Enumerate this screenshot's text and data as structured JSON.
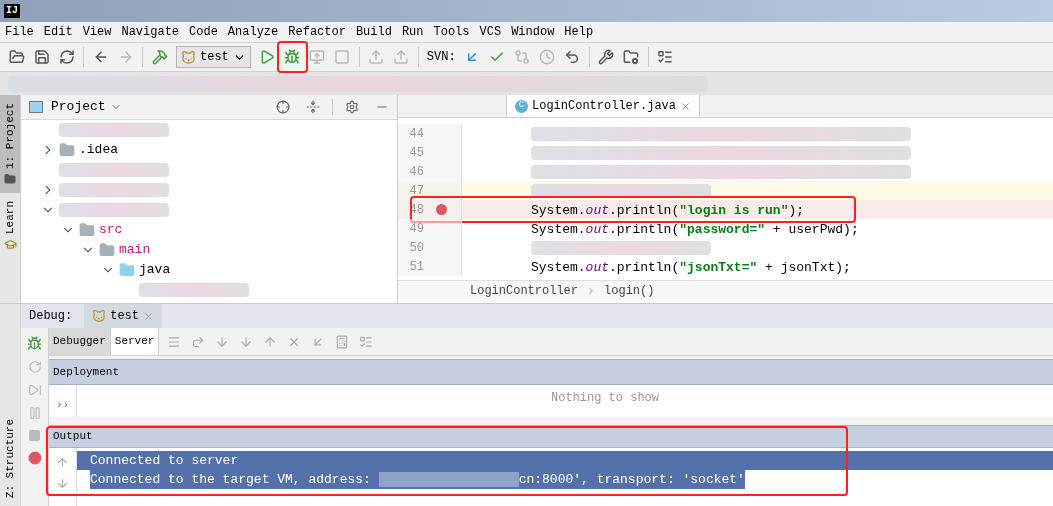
{
  "window": {
    "logo": "IJ"
  },
  "menu": [
    "File",
    "Edit",
    "View",
    "Navigate",
    "Code",
    "Analyze",
    "Refactor",
    "Build",
    "Run",
    "Tools",
    "VCS",
    "Window",
    "Help"
  ],
  "toolbar": [
    {
      "kind": "open",
      "disabled": false
    },
    {
      "kind": "save",
      "disabled": false
    },
    {
      "kind": "sync",
      "disabled": false
    },
    {
      "kind": "sep"
    },
    {
      "kind": "back",
      "disabled": false
    },
    {
      "kind": "forward",
      "disabled": true
    },
    {
      "kind": "sep"
    },
    {
      "kind": "build",
      "disabled": false
    },
    {
      "kind": "config",
      "label": "test"
    },
    {
      "kind": "run",
      "disabled": false
    },
    {
      "kind": "debug",
      "disabled": false,
      "annotated": true
    },
    {
      "kind": "coverage",
      "disabled": true
    },
    {
      "kind": "stop",
      "disabled": true
    },
    {
      "kind": "sep"
    },
    {
      "kind": "attach",
      "disabled": true
    },
    {
      "kind": "deploy",
      "disabled": true
    },
    {
      "kind": "sep"
    },
    {
      "kind": "label",
      "label": "SVN:"
    },
    {
      "kind": "update",
      "disabled": false
    },
    {
      "kind": "commit",
      "disabled": false
    },
    {
      "kind": "compare",
      "disabled": true
    },
    {
      "kind": "history",
      "disabled": true
    },
    {
      "kind": "revert",
      "disabled": false
    },
    {
      "kind": "sep"
    },
    {
      "kind": "settings",
      "disabled": false
    },
    {
      "kind": "structure",
      "disabled": false
    },
    {
      "kind": "sep"
    },
    {
      "kind": "tasks",
      "disabled": false
    }
  ],
  "side_tabs": [
    {
      "label": "1: Project",
      "kind": "folder",
      "selected": true
    },
    {
      "label": "Learn",
      "kind": "learn",
      "selected": false
    }
  ],
  "bottom_side_tab": {
    "label": "Z: Structure"
  },
  "project": {
    "title": "Project",
    "tree": [
      {
        "kind": "redacted"
      },
      {
        "kind": "folder",
        "label": ".idea",
        "expanded": false
      },
      {
        "kind": "redacted"
      },
      {
        "kind": "redacted",
        "expanded": false
      },
      {
        "kind": "redacted",
        "expanded": true,
        "children": [
          {
            "kind": "folder",
            "label": "src",
            "color": "#c3157a",
            "expanded": true,
            "children": [
              {
                "kind": "folder",
                "label": "main",
                "color": "#c3157a",
                "expanded": true,
                "children": [
                  {
                    "kind": "source",
                    "label": "java",
                    "expanded": true,
                    "children": [
                      {
                        "kind": "redacted"
                      }
                    ]
                  }
                ]
              }
            ]
          }
        ]
      }
    ]
  },
  "editor": {
    "tabs": [
      {
        "label": "LoginController.java",
        "icon": "C",
        "selected": true
      }
    ],
    "lines": [
      {
        "number": "44",
        "kind": "redacted"
      },
      {
        "number": "45",
        "kind": "redacted"
      },
      {
        "number": "46",
        "kind": "redacted"
      },
      {
        "number": "47",
        "kind": "redacted",
        "current": true
      },
      {
        "number": "48",
        "breakpoint": true,
        "annotated": true,
        "tokens": [
          {
            "text": "System.",
            "kind": "plain"
          },
          {
            "text": "out",
            "kind": "field"
          },
          {
            "text": ".println(",
            "kind": "plain"
          },
          {
            "text": "\"login is run\"",
            "kind": "string"
          },
          {
            "text": ");",
            "kind": "plain"
          }
        ]
      },
      {
        "number": "49",
        "tokens": [
          {
            "text": "System.",
            "kind": "plain"
          },
          {
            "text": "out",
            "kind": "field"
          },
          {
            "text": ".println(",
            "kind": "plain"
          },
          {
            "text": "\"password=\"",
            "kind": "string"
          },
          {
            "text": " + userPwd);",
            "kind": "plain"
          }
        ]
      },
      {
        "number": "50",
        "kind": "redacted"
      },
      {
        "number": "51",
        "tokens": [
          {
            "text": "System.",
            "kind": "plain"
          },
          {
            "text": "out",
            "kind": "field"
          },
          {
            "text": ".println(",
            "kind": "plain"
          },
          {
            "text": "\"jsonTxt=\"",
            "kind": "string"
          },
          {
            "text": " + jsonTxt);",
            "kind": "plain"
          }
        ]
      }
    ],
    "breadcrumbs": [
      "LoginController",
      "login()"
    ]
  },
  "debug": {
    "title": "Debug:",
    "tab": "test",
    "subtabs": [
      {
        "label": "Debugger",
        "selected": false
      },
      {
        "label": "Server",
        "selected": true
      }
    ],
    "deployment": {
      "title": "Deployment",
      "empty": "Nothing to show",
      "expand": "››"
    },
    "output": {
      "title": "Output",
      "annotated": true,
      "lines": [
        {
          "text": "Connected to server",
          "selected": true
        },
        {
          "text": "Connected to the target VM, address: ",
          "redacted": true,
          "rest": "cn:8000', transport: 'socket'",
          "selected": true
        }
      ]
    }
  }
}
